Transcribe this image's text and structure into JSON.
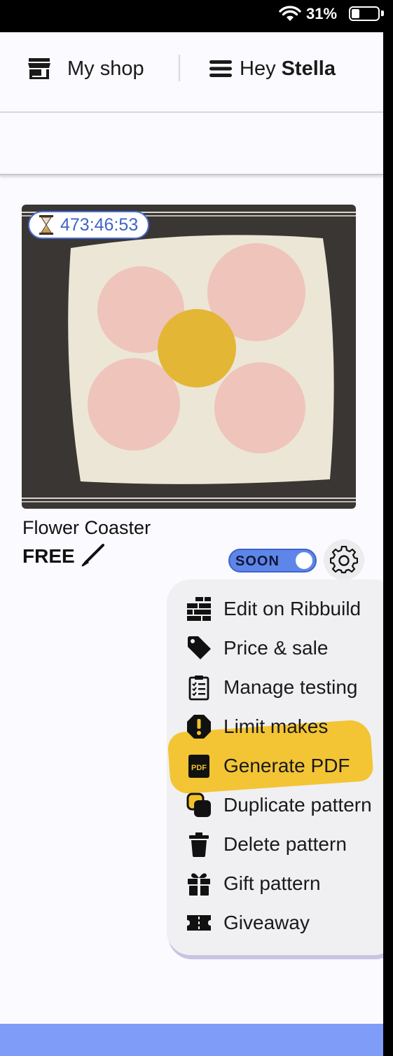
{
  "status_bar": {
    "battery_percent": "31%",
    "battery_level": 0.31
  },
  "header": {
    "shop_label": "My shop",
    "greeting": "Hey",
    "user_name": "Stella"
  },
  "card": {
    "timer": "473:46:53",
    "title": "Flower Coaster",
    "price": "FREE",
    "toggle_label": "SOON",
    "toggle_on": true
  },
  "menu": {
    "items": [
      {
        "label": "Edit on Ribbuild",
        "icon": "bricks-icon"
      },
      {
        "label": "Price & sale",
        "icon": "price-tag-icon"
      },
      {
        "label": "Manage testing",
        "icon": "clipboard-checklist-icon"
      },
      {
        "label": "Limit makes",
        "icon": "exclamation-octagon-icon"
      },
      {
        "label": "Generate PDF",
        "icon": "pdf-icon"
      },
      {
        "label": "Duplicate pattern",
        "icon": "duplicate-icon"
      },
      {
        "label": "Delete pattern",
        "icon": "trash-icon"
      },
      {
        "label": " Gift pattern",
        "icon": "gift-icon"
      },
      {
        "label": "Giveaway",
        "icon": "ticket-icon"
      }
    ]
  },
  "colors": {
    "accent": "#4a6fd8",
    "toggle": "#5e86e8",
    "highlight": "#f2c22a",
    "bottom_bar": "#7f9df8"
  }
}
